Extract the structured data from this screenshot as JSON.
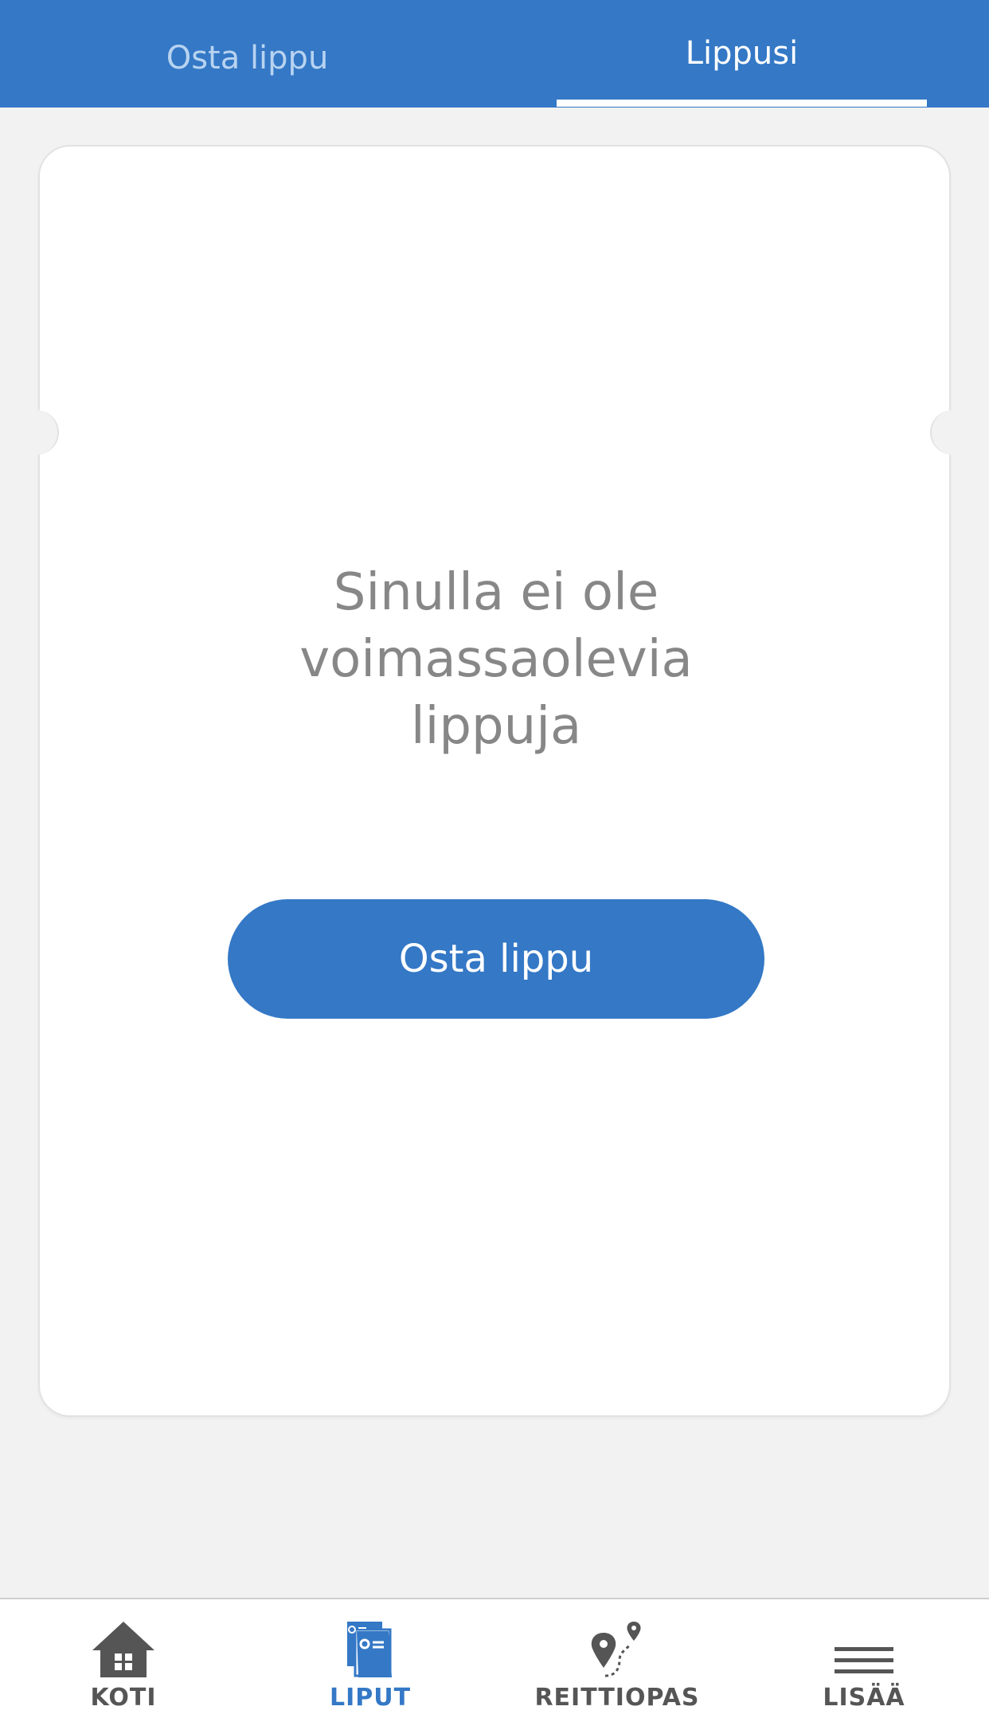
{
  "top_tabs": {
    "buy_ticket": "Osta lippu",
    "your_tickets": "Lippusi",
    "active_tab": "your_tickets"
  },
  "card": {
    "empty_message_line1": "Sinulla ei ole",
    "empty_message_line2": "voimassaolevia",
    "empty_message_line3": "lippuja",
    "buy_button_label": "Osta lippu"
  },
  "bottom_nav": {
    "items": [
      {
        "label": "KOTI",
        "icon": "home-icon",
        "active": false
      },
      {
        "label": "LIPUT",
        "icon": "tickets-icon",
        "active": true
      },
      {
        "label": "REITTIOPAS",
        "icon": "route-planner-icon",
        "active": false
      },
      {
        "label": "LISÄÄ",
        "icon": "menu-icon",
        "active": false
      }
    ]
  },
  "colors": {
    "brand_blue": "#3478c6",
    "inactive_tab_text": "#b8d3f0",
    "message_gray": "#878787",
    "nav_gray": "#555555",
    "background": "#f2f2f2"
  }
}
